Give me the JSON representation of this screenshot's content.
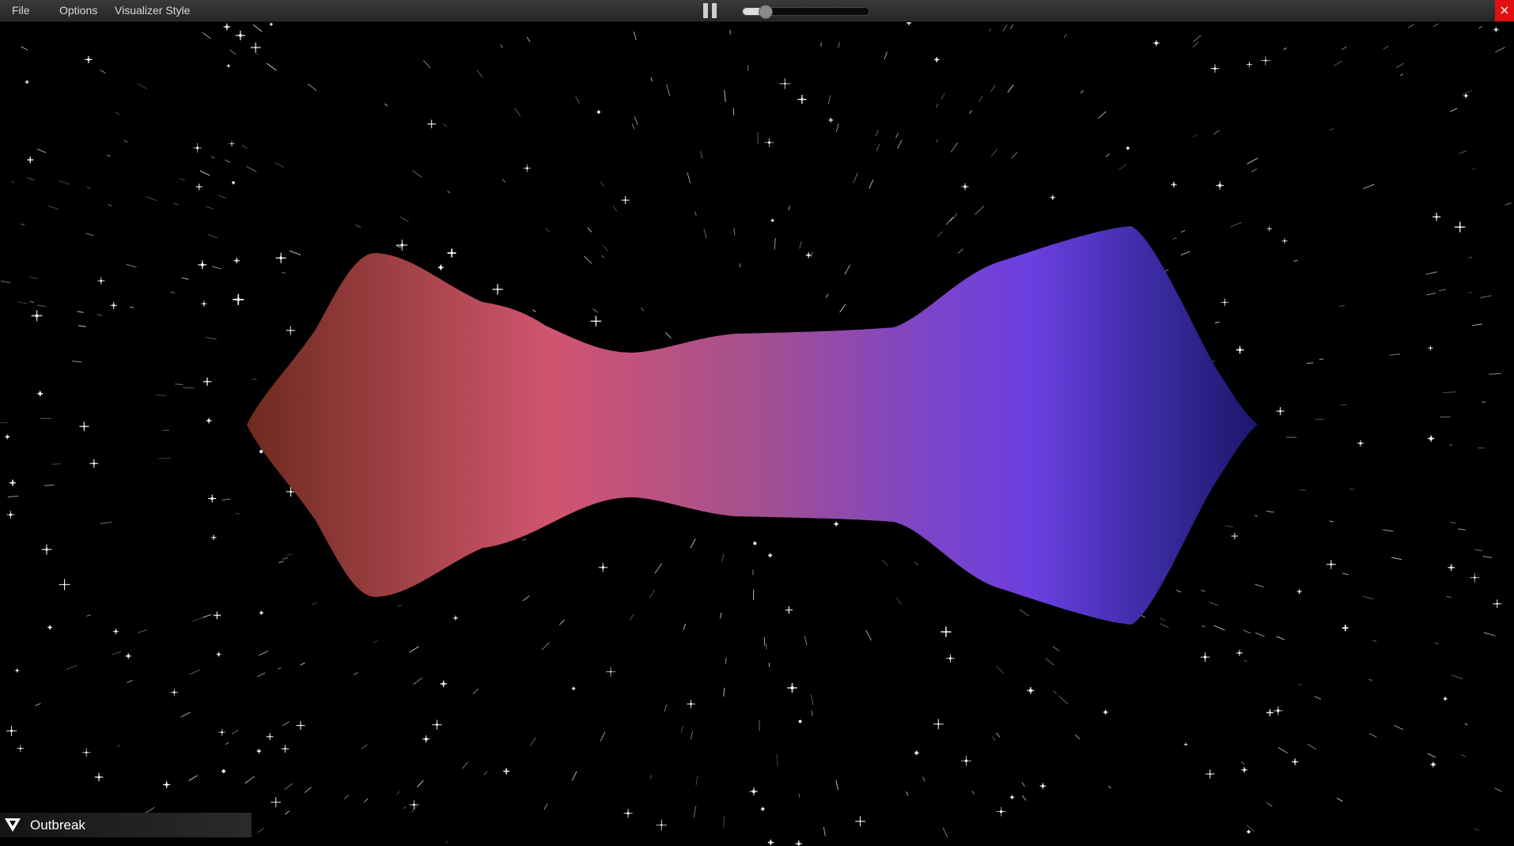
{
  "menu": {
    "file": "File",
    "options": "Options",
    "style": "Visualizer Style"
  },
  "toolbar": {
    "pause_icon": "pause-icon",
    "close_label": "×",
    "close_color": "#e01010"
  },
  "volume": {
    "level": 0.14
  },
  "track": {
    "name": "Outbreak",
    "icon": "triangle-down-icon"
  },
  "visual": {
    "colors": [
      "#6e2a1f",
      "#b04852",
      "#d15470",
      "#a6508f",
      "#7e45c6",
      "#6a3ee0",
      "#3a2aa0",
      "#1c166a"
    ]
  }
}
